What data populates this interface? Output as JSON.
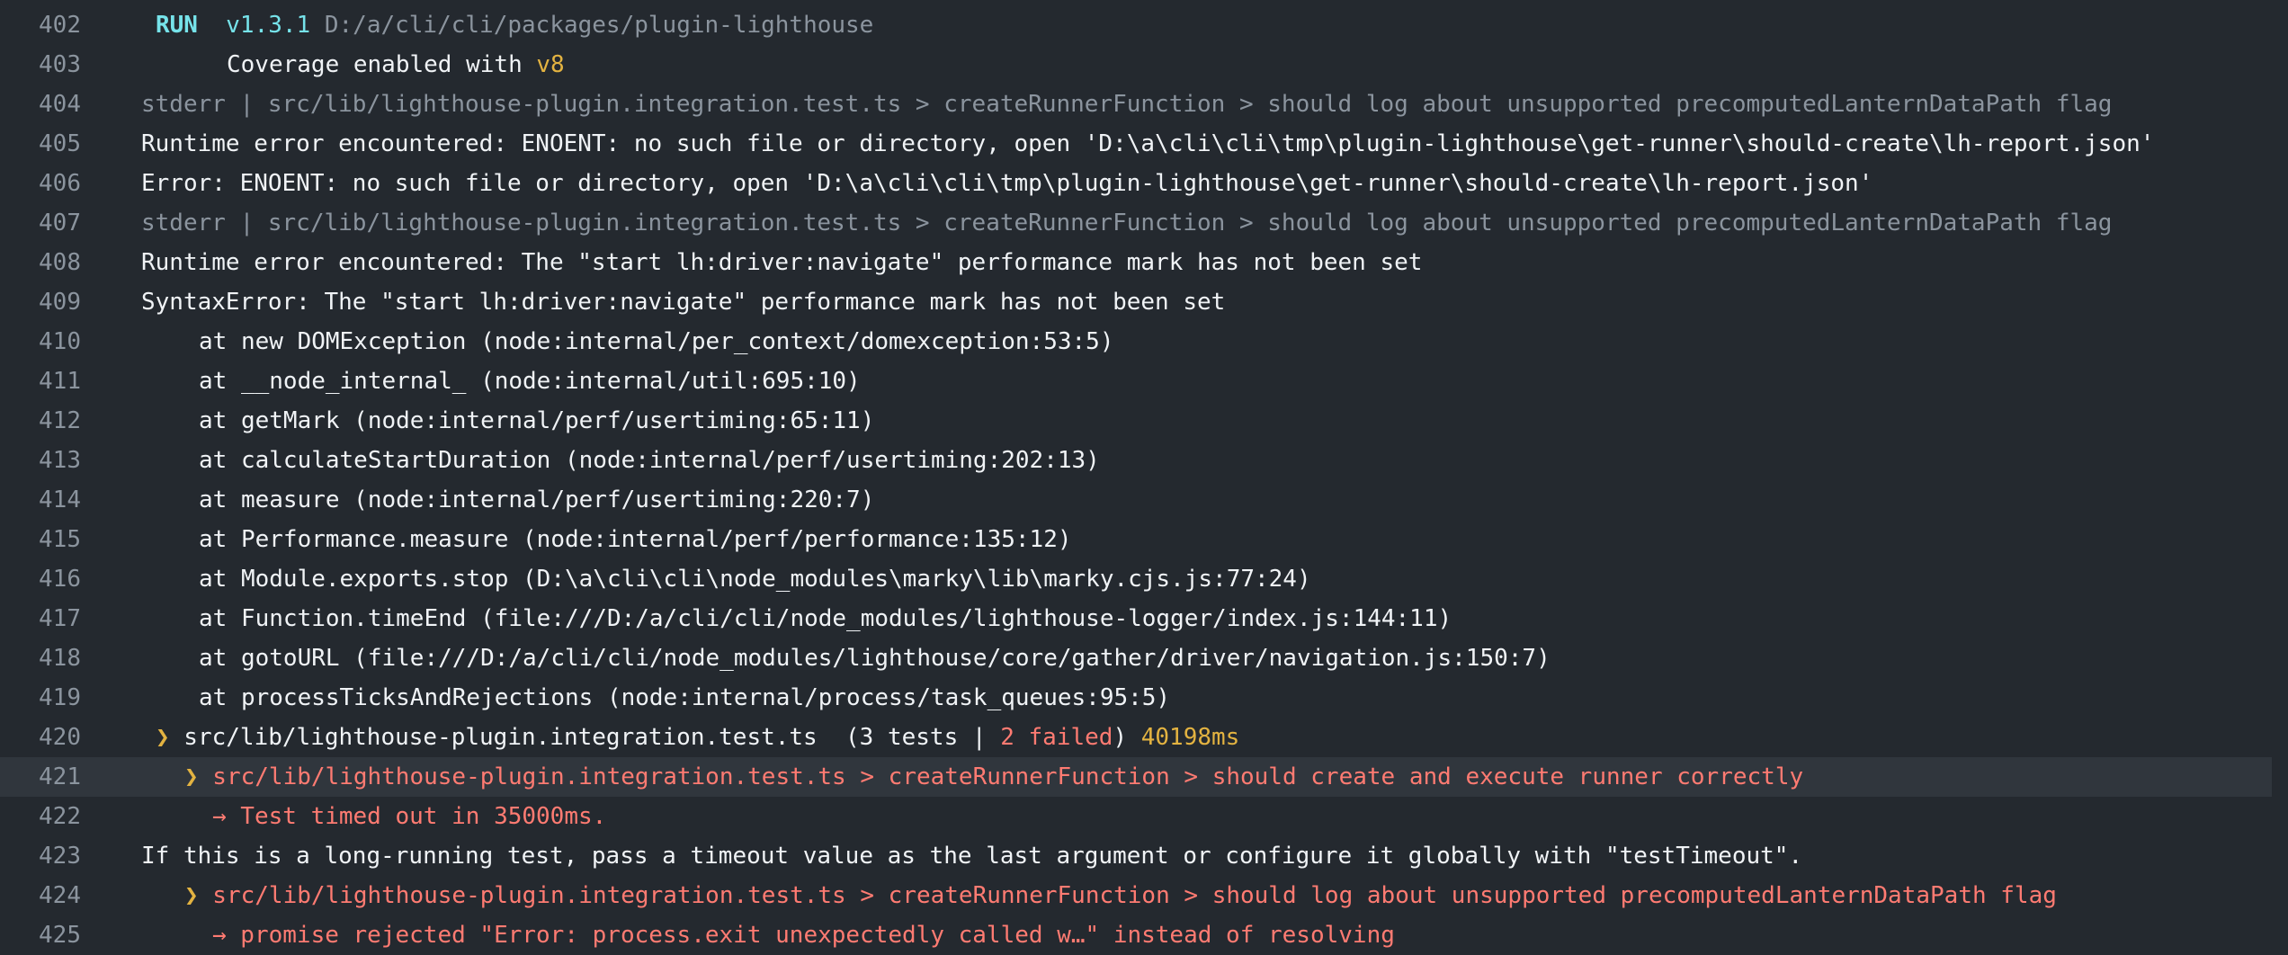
{
  "colors": {
    "background": "#24292f",
    "line_number": "#8b949e",
    "text": "#f0f3f6",
    "muted": "#8b949e",
    "accent_cyan": "#76e3ea",
    "warning_yellow": "#e3b341",
    "error_red": "#ff7b72",
    "highlight_row": "#30363d"
  },
  "icons": {
    "chevron": "chevron-right-icon",
    "arrow": "arrow-right-icon"
  },
  "lines": {
    "l402": {
      "n": "402",
      "badge": "RUN",
      "version": "v1.3.1",
      "path": "D:/a/cli/cli/packages/plugin-lighthouse"
    },
    "l403": {
      "n": "403",
      "text": "Coverage enabled with ",
      "provider": "v8"
    },
    "l404": {
      "n": "404",
      "text": "stderr | src/lib/lighthouse-plugin.integration.test.ts > createRunnerFunction > should log about unsupported precomputedLanternDataPath flag"
    },
    "l405": {
      "n": "405",
      "text": "Runtime error encountered: ENOENT: no such file or directory, open 'D:\\a\\cli\\cli\\tmp\\plugin-lighthouse\\get-runner\\should-create\\lh-report.json'"
    },
    "l406": {
      "n": "406",
      "text": "Error: ENOENT: no such file or directory, open 'D:\\a\\cli\\cli\\tmp\\plugin-lighthouse\\get-runner\\should-create\\lh-report.json'"
    },
    "l407": {
      "n": "407",
      "text": "stderr | src/lib/lighthouse-plugin.integration.test.ts > createRunnerFunction > should log about unsupported precomputedLanternDataPath flag"
    },
    "l408": {
      "n": "408",
      "text": "Runtime error encountered: The \"start lh:driver:navigate\" performance mark has not been set"
    },
    "l409": {
      "n": "409",
      "text": "SyntaxError: The \"start lh:driver:navigate\" performance mark has not been set"
    },
    "l410": {
      "n": "410",
      "text": "at new DOMException (node:internal/per_context/domexception:53:5)"
    },
    "l411": {
      "n": "411",
      "text": "at __node_internal_ (node:internal/util:695:10)"
    },
    "l412": {
      "n": "412",
      "text": "at getMark (node:internal/perf/usertiming:65:11)"
    },
    "l413": {
      "n": "413",
      "text": "at calculateStartDuration (node:internal/perf/usertiming:202:13)"
    },
    "l414": {
      "n": "414",
      "text": "at measure (node:internal/perf/usertiming:220:7)"
    },
    "l415": {
      "n": "415",
      "text": "at Performance.measure (node:internal/perf/performance:135:12)"
    },
    "l416": {
      "n": "416",
      "text": "at Module.exports.stop (D:\\a\\cli\\cli\\node_modules\\marky\\lib\\marky.cjs.js:77:24)"
    },
    "l417": {
      "n": "417",
      "text": "at Function.timeEnd (file:///D:/a/cli/cli/node_modules/lighthouse-logger/index.js:144:11)"
    },
    "l418": {
      "n": "418",
      "text": "at gotoURL (file:///D:/a/cli/cli/node_modules/lighthouse/core/gather/driver/navigation.js:150:7)"
    },
    "l419": {
      "n": "419",
      "text": "at processTicksAndRejections (node:internal/process/task_queues:95:5)"
    },
    "l420": {
      "n": "420",
      "chevron": "❯",
      "file": " src/lib/lighthouse-plugin.integration.test.ts  (3 tests | ",
      "failed": "2 failed",
      "close": ")",
      "duration": "40198ms"
    },
    "l421": {
      "n": "421",
      "chevron": "❯",
      "text": " src/lib/lighthouse-plugin.integration.test.ts > createRunnerFunction > should create and execute runner correctly"
    },
    "l422": {
      "n": "422",
      "text": "→ Test timed out in 35000ms."
    },
    "l423": {
      "n": "423",
      "text": "If this is a long-running test, pass a timeout value as the last argument or configure it globally with \"testTimeout\"."
    },
    "l424": {
      "n": "424",
      "chevron": "❯",
      "text": " src/lib/lighthouse-plugin.integration.test.ts > createRunnerFunction > should log about unsupported precomputedLanternDataPath flag"
    },
    "l425": {
      "n": "425",
      "text": "→ promise rejected \"Error: process.exit unexpectedly called w…\" instead of resolving"
    }
  }
}
